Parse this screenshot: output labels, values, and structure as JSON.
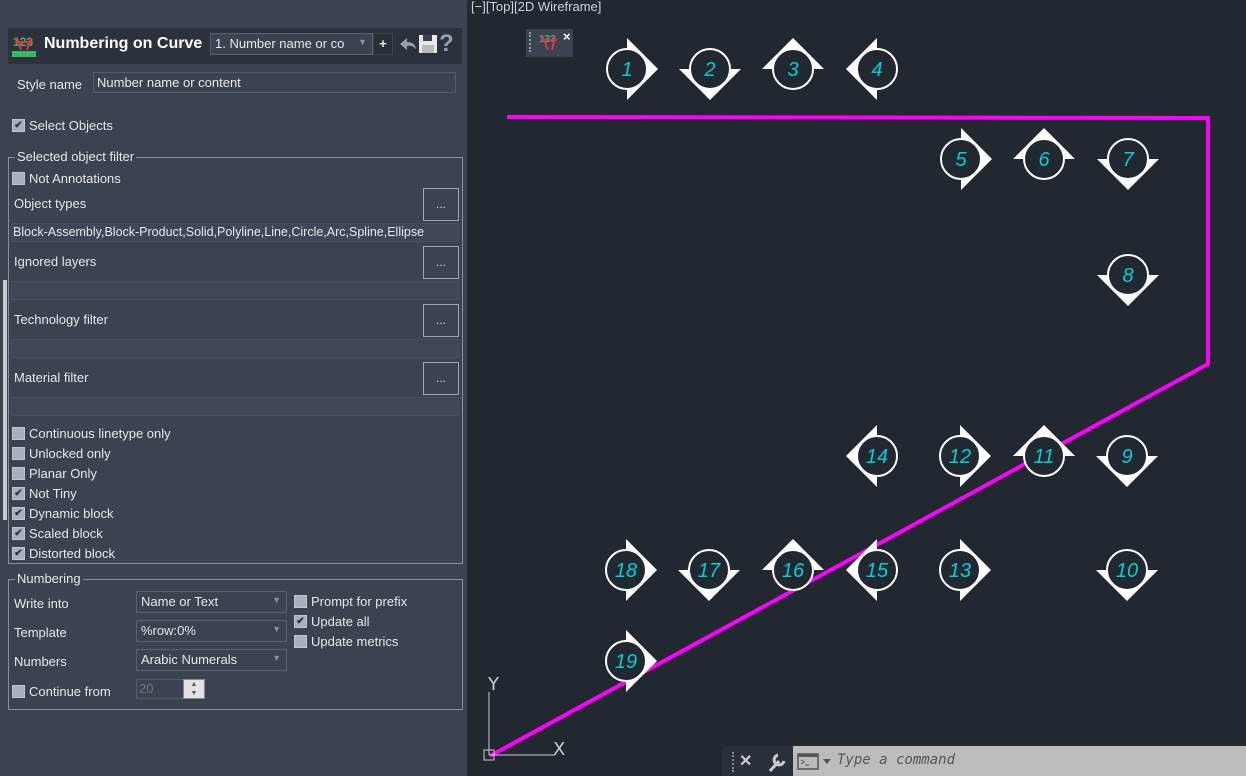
{
  "header": {
    "title": "Numbering on Curve",
    "style_combo": "1. Number name or co",
    "add_label": "+",
    "undo_icon": "undo-arrow-icon",
    "save_icon": "floppy-save-icon",
    "help_label": "?"
  },
  "style_name": {
    "label": "Style name",
    "value": "Number name or content"
  },
  "select_objects": {
    "label": "Select Objects",
    "checked": true
  },
  "filter": {
    "title": "Selected object filter",
    "not_annotations": {
      "label": "Not Annotations",
      "checked": false
    },
    "object_types": {
      "label": "Object types",
      "button": "...",
      "value": "Block-Assembly,Block-Product,Solid,Polyline,Line,Circle,Arc,Spline,Ellipse"
    },
    "ignored_layers": {
      "label": "Ignored layers",
      "button": "...",
      "value": ""
    },
    "technology_filter": {
      "label": "Technology filter",
      "button": "...",
      "value": ""
    },
    "material_filter": {
      "label": "Material filter",
      "button": "...",
      "value": ""
    },
    "checks": [
      {
        "label": "Continuous linetype only",
        "checked": false
      },
      {
        "label": "Unlocked only",
        "checked": false
      },
      {
        "label": "Planar Only",
        "checked": false
      },
      {
        "label": "Not Tiny",
        "checked": true
      },
      {
        "label": "Dynamic block",
        "checked": true
      },
      {
        "label": "Scaled block",
        "checked": true
      },
      {
        "label": "Distorted block",
        "checked": true
      }
    ]
  },
  "numbering": {
    "title": "Numbering",
    "write_into": {
      "label": "Write into",
      "value": "Name or Text"
    },
    "template": {
      "label": "Template",
      "value": "%row:0%"
    },
    "numbers": {
      "label": "Numbers",
      "value": "Arabic Numerals"
    },
    "continue_from": {
      "label": "Continue from",
      "checked": false,
      "value": "20"
    },
    "prompt_prefix": {
      "label": "Prompt for prefix",
      "checked": false
    },
    "update_all": {
      "label": "Update all",
      "checked": true
    },
    "update_metrics": {
      "label": "Update metrics",
      "checked": false
    }
  },
  "viewport": {
    "label": "[−][Top][2D Wireframe]",
    "close_label": "×",
    "curve_color": "#ff00ff",
    "marker_text_color": "#00d0d8",
    "axis_x": "X",
    "axis_y": "Y",
    "markers": [
      {
        "label": "1",
        "direction": "right"
      },
      {
        "label": "2",
        "direction": "down"
      },
      {
        "label": "3",
        "direction": "up"
      },
      {
        "label": "4",
        "direction": "left"
      },
      {
        "label": "5",
        "direction": "right"
      },
      {
        "label": "6",
        "direction": "up"
      },
      {
        "label": "7",
        "direction": "down"
      },
      {
        "label": "8",
        "direction": "down"
      },
      {
        "label": "9",
        "direction": "down"
      },
      {
        "label": "10",
        "direction": "down"
      },
      {
        "label": "11",
        "direction": "up"
      },
      {
        "label": "12",
        "direction": "right"
      },
      {
        "label": "13",
        "direction": "right"
      },
      {
        "label": "14",
        "direction": "left"
      },
      {
        "label": "15",
        "direction": "left"
      },
      {
        "label": "16",
        "direction": "up"
      },
      {
        "label": "17",
        "direction": "down"
      },
      {
        "label": "18",
        "direction": "right"
      },
      {
        "label": "19",
        "direction": "right"
      }
    ]
  },
  "command": {
    "close": "✕",
    "placeholder": "Type a command"
  }
}
